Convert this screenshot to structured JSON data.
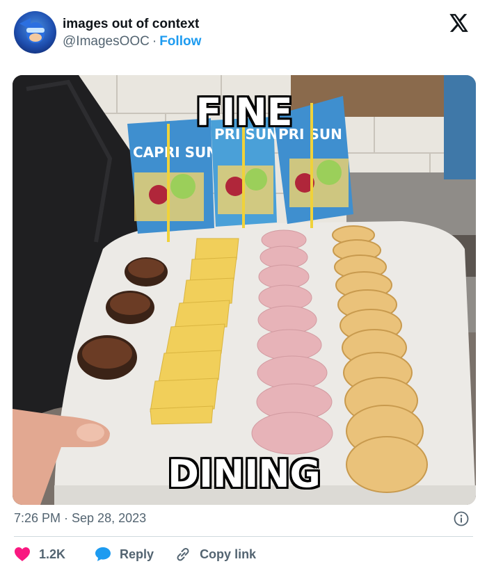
{
  "header": {
    "display_name": "images out of context",
    "handle": "@ImagesOOC",
    "separator": "·",
    "follow_label": "Follow"
  },
  "media": {
    "top_caption": "FINE",
    "bottom_caption": "DINING"
  },
  "meta": {
    "timestamp": "7:26 PM · Sep 28, 2023"
  },
  "actions": {
    "like_count": "1.2K",
    "reply_label": "Reply",
    "copy_link_label": "Copy link"
  },
  "colors": {
    "accent": "#1d9bf0",
    "like": "#f91880",
    "muted": "#536471"
  },
  "icons": [
    "x-logo-icon",
    "info-icon",
    "heart-icon",
    "reply-bubble-icon",
    "link-icon"
  ]
}
